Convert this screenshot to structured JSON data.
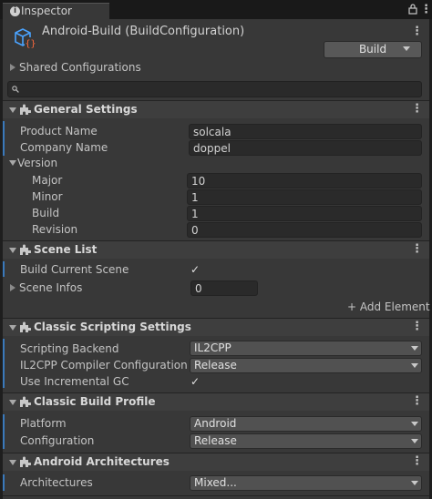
{
  "tab": {
    "label": "Inspector"
  },
  "header": {
    "title": "Android-Build (BuildConfiguration)",
    "build_label": "Build"
  },
  "shared": {
    "label": "Shared Configurations"
  },
  "search": {
    "placeholder": ""
  },
  "general": {
    "title": "General Settings",
    "product_name_label": "Product Name",
    "product_name_value": "solcala",
    "company_name_label": "Company Name",
    "company_name_value": "doppel",
    "version_label": "Version",
    "major_label": "Major",
    "major_value": "10",
    "minor_label": "Minor",
    "minor_value": "1",
    "build_label": "Build",
    "build_value": "1",
    "revision_label": "Revision",
    "revision_value": "0"
  },
  "scene_list": {
    "title": "Scene List",
    "build_current_label": "Build Current Scene",
    "build_current_checked": true,
    "scene_infos_label": "Scene Infos",
    "scene_infos_value": "0",
    "add_element_label": "+ Add Element"
  },
  "scripting": {
    "title": "Classic Scripting Settings",
    "backend_label": "Scripting Backend",
    "backend_value": "IL2CPP",
    "compiler_label": "IL2CPP Compiler Configuration",
    "compiler_value": "Release",
    "incremental_gc_label": "Use Incremental GC",
    "incremental_gc_checked": true
  },
  "build_profile": {
    "title": "Classic Build Profile",
    "platform_label": "Platform",
    "platform_value": "Android",
    "configuration_label": "Configuration",
    "configuration_value": "Release"
  },
  "architectures": {
    "title": "Android Architectures",
    "arch_label": "Architectures",
    "arch_value": "Mixed..."
  },
  "glyphs": {
    "kebab": "⋮",
    "check": "✓",
    "info": "i"
  },
  "colors": {
    "accent": "#3a79bb",
    "panel": "#383838",
    "section": "#3e3e3e",
    "field": "#2a2a2a"
  }
}
